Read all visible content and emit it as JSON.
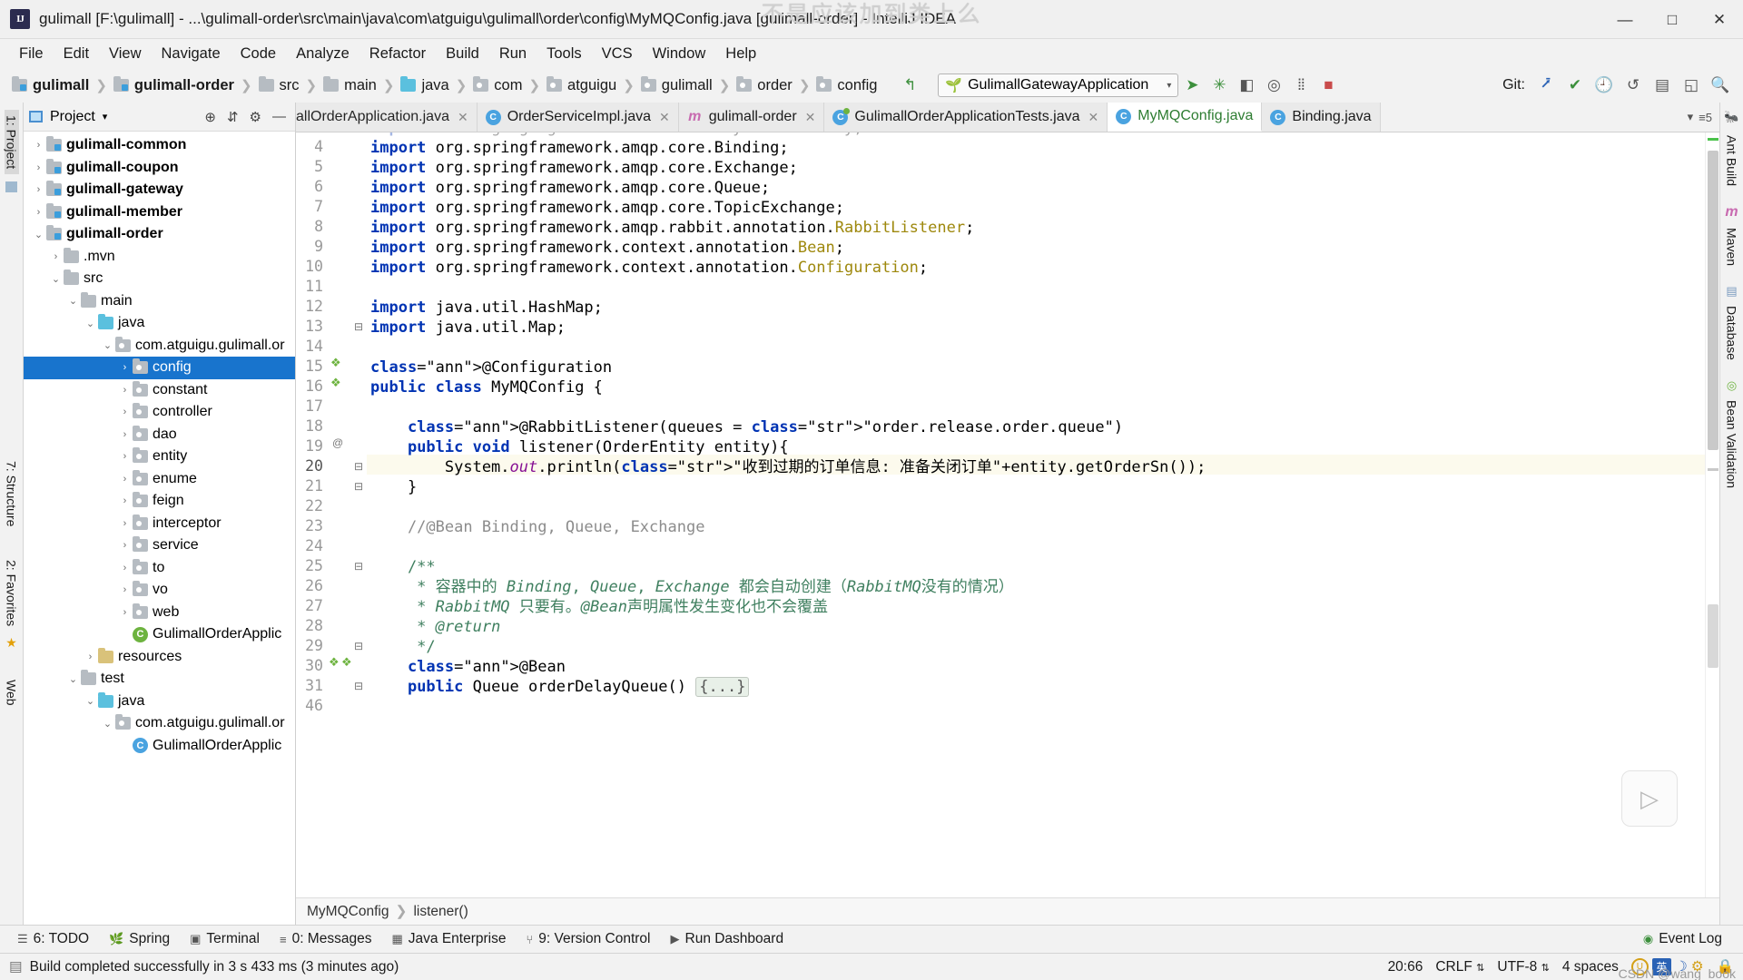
{
  "window": {
    "title": "gulimall [F:\\gulimall] - ...\\gulimall-order\\src\\main\\java\\com\\atguigu\\gulimall\\order\\config\\MyMQConfig.java [gulimall-order] - IntelliJ IDEA",
    "logo_text": "IJ",
    "watermark": "不是应该加到类上么",
    "minimize": "—",
    "maximize": "□",
    "close": "✕"
  },
  "menu": {
    "items": [
      "File",
      "Edit",
      "View",
      "Navigate",
      "Code",
      "Analyze",
      "Refactor",
      "Build",
      "Run",
      "Tools",
      "VCS",
      "Window",
      "Help"
    ]
  },
  "navbar": {
    "breadcrumbs": [
      {
        "label": "gulimall",
        "icon": "module-folder-icon",
        "bold": true,
        "kind": "module"
      },
      {
        "label": "gulimall-order",
        "icon": "module-folder-icon",
        "bold": true,
        "kind": "module"
      },
      {
        "label": "src",
        "icon": "folder-icon",
        "bold": false,
        "kind": "folder"
      },
      {
        "label": "main",
        "icon": "folder-icon",
        "bold": false,
        "kind": "folder"
      },
      {
        "label": "java",
        "icon": "source-folder-icon",
        "bold": false,
        "kind": "source"
      },
      {
        "label": "com",
        "icon": "package-icon",
        "bold": false,
        "kind": "package"
      },
      {
        "label": "atguigu",
        "icon": "package-icon",
        "bold": false,
        "kind": "package"
      },
      {
        "label": "gulimall",
        "icon": "package-icon",
        "bold": false,
        "kind": "package"
      },
      {
        "label": "order",
        "icon": "package-icon",
        "bold": false,
        "kind": "package"
      },
      {
        "label": "config",
        "icon": "package-icon",
        "bold": false,
        "kind": "package"
      }
    ],
    "run_config": "GulimallGatewayApplication",
    "git_label": "Git:",
    "icons": [
      "back-arrow-icon",
      "run-icon",
      "debug-icon",
      "coverage-icon",
      "profile-icon",
      "stop-icon",
      "build-icon",
      "update-project-icon",
      "commit-icon",
      "history-icon",
      "rollback-icon",
      "search-everywhere-icon"
    ]
  },
  "project_panel": {
    "title": "Project",
    "header_icons": [
      "locate-icon",
      "collapse-all-icon",
      "settings-icon",
      "hide-icon"
    ],
    "tree": [
      {
        "label": "gulimall-common",
        "depth": 0,
        "arrow": "right",
        "icon": "module-folder-icon",
        "bold": true,
        "selected": false
      },
      {
        "label": "gulimall-coupon",
        "depth": 0,
        "arrow": "right",
        "icon": "module-folder-icon",
        "bold": true,
        "selected": false
      },
      {
        "label": "gulimall-gateway",
        "depth": 0,
        "arrow": "right",
        "icon": "module-folder-icon",
        "bold": true,
        "selected": false
      },
      {
        "label": "gulimall-member",
        "depth": 0,
        "arrow": "right",
        "icon": "module-folder-icon",
        "bold": true,
        "selected": false
      },
      {
        "label": "gulimall-order",
        "depth": 0,
        "arrow": "down",
        "icon": "module-folder-icon",
        "bold": true,
        "selected": false
      },
      {
        "label": ".mvn",
        "depth": 1,
        "arrow": "right",
        "icon": "folder-icon",
        "bold": false,
        "selected": false
      },
      {
        "label": "src",
        "depth": 1,
        "arrow": "down",
        "icon": "folder-icon",
        "bold": false,
        "selected": false
      },
      {
        "label": "main",
        "depth": 2,
        "arrow": "down",
        "icon": "folder-icon",
        "bold": false,
        "selected": false
      },
      {
        "label": "java",
        "depth": 3,
        "arrow": "down",
        "icon": "source-folder-icon",
        "bold": false,
        "selected": false
      },
      {
        "label": "com.atguigu.gulimall.or",
        "depth": 4,
        "arrow": "down",
        "icon": "package-icon",
        "bold": false,
        "selected": false
      },
      {
        "label": "config",
        "depth": 5,
        "arrow": "right",
        "icon": "package-icon",
        "bold": false,
        "selected": true
      },
      {
        "label": "constant",
        "depth": 5,
        "arrow": "right",
        "icon": "package-icon",
        "bold": false,
        "selected": false
      },
      {
        "label": "controller",
        "depth": 5,
        "arrow": "right",
        "icon": "package-icon",
        "bold": false,
        "selected": false
      },
      {
        "label": "dao",
        "depth": 5,
        "arrow": "right",
        "icon": "package-icon",
        "bold": false,
        "selected": false
      },
      {
        "label": "entity",
        "depth": 5,
        "arrow": "right",
        "icon": "package-icon",
        "bold": false,
        "selected": false
      },
      {
        "label": "enume",
        "depth": 5,
        "arrow": "right",
        "icon": "package-icon",
        "bold": false,
        "selected": false
      },
      {
        "label": "feign",
        "depth": 5,
        "arrow": "right",
        "icon": "package-icon",
        "bold": false,
        "selected": false
      },
      {
        "label": "interceptor",
        "depth": 5,
        "arrow": "right",
        "icon": "package-icon",
        "bold": false,
        "selected": false
      },
      {
        "label": "service",
        "depth": 5,
        "arrow": "right",
        "icon": "package-icon",
        "bold": false,
        "selected": false
      },
      {
        "label": "to",
        "depth": 5,
        "arrow": "right",
        "icon": "package-icon",
        "bold": false,
        "selected": false
      },
      {
        "label": "vo",
        "depth": 5,
        "arrow": "right",
        "icon": "package-icon",
        "bold": false,
        "selected": false
      },
      {
        "label": "web",
        "depth": 5,
        "arrow": "right",
        "icon": "package-icon",
        "bold": false,
        "selected": false
      },
      {
        "label": "GulimallOrderApplic",
        "depth": 5,
        "arrow": "none",
        "icon": "spring-class-icon",
        "bold": false,
        "selected": false
      },
      {
        "label": "resources",
        "depth": 3,
        "arrow": "right",
        "icon": "resources-folder-icon",
        "bold": false,
        "selected": false
      },
      {
        "label": "test",
        "depth": 2,
        "arrow": "down",
        "icon": "folder-icon",
        "bold": false,
        "selected": false
      },
      {
        "label": "java",
        "depth": 3,
        "arrow": "down",
        "icon": "source-folder-icon",
        "bold": false,
        "selected": false
      },
      {
        "label": "com.atguigu.gulimall.or",
        "depth": 4,
        "arrow": "down",
        "icon": "package-icon",
        "bold": false,
        "selected": false
      },
      {
        "label": "GulimallOrderApplic",
        "depth": 5,
        "arrow": "none",
        "icon": "test-class-icon",
        "bold": false,
        "selected": false
      }
    ]
  },
  "left_strip": [
    "1: Project",
    "7: Structure",
    "2: Favorites",
    "Web"
  ],
  "right_strip": [
    "Ant Build",
    "Maven",
    "Database",
    "Bean Validation"
  ],
  "editor_tabs": [
    {
      "label": "allOrderApplication.java",
      "icon": "java-class-icon",
      "active": false,
      "closable": true,
      "truncated": true
    },
    {
      "label": "OrderServiceImpl.java",
      "icon": "java-class-icon",
      "active": false,
      "closable": true
    },
    {
      "label": "gulimall-order",
      "icon": "maven-icon",
      "active": false,
      "closable": true
    },
    {
      "label": "GulimallOrderApplicationTests.java",
      "icon": "test-class-icon",
      "active": false,
      "closable": true
    },
    {
      "label": "MyMQConfig.java",
      "icon": "java-class-icon",
      "active": true,
      "closable": false
    },
    {
      "label": "Binding.java",
      "icon": "java-class-icon",
      "active": false,
      "closable": false
    }
  ],
  "editor": {
    "gutter_line_numbers": [
      "4",
      "5",
      "6",
      "7",
      "8",
      "9",
      "10",
      "11",
      "12",
      "13",
      "14",
      "15",
      "16",
      "17",
      "18",
      "19",
      "20",
      "21",
      "22",
      "23",
      "24",
      "25",
      "26",
      "27",
      "28",
      "29",
      "30",
      "31",
      "46"
    ],
    "highlighted_line": "20",
    "code_lines": [
      "import com.atguigu.gulimall.order.entity.OrderEntity;",
      "import org.springframework.amqp.core.Binding;",
      "import org.springframework.amqp.core.Exchange;",
      "import org.springframework.amqp.core.Queue;",
      "import org.springframework.amqp.core.TopicExchange;",
      "import org.springframework.amqp.rabbit.annotation.RabbitListener;",
      "import org.springframework.context.annotation.Bean;",
      "import org.springframework.context.annotation.Configuration;",
      "",
      "import java.util.HashMap;",
      "import java.util.Map;",
      "",
      "@Configuration",
      "public class MyMQConfig {",
      "",
      "    @RabbitListener(queues = \"order.release.order.queue\")",
      "    public void listener(OrderEntity entity){",
      "        System.out.println(\"收到过期的订单信息: 准备关闭订单\"+entity.getOrderSn());",
      "    }",
      "",
      "    //@Bean Binding, Queue, Exchange",
      "",
      "    /**",
      "     * 容器中的 Binding, Queue, Exchange 都会自动创建（RabbitMQ没有的情况）",
      "     * RabbitMQ 只要有。@Bean声明属性发生变化也不会覆盖",
      "     * @return",
      "     */",
      "    @Bean",
      "    public Queue orderDelayQueue() {...}"
    ],
    "fold_placeholder": "{...}",
    "breadcrumb": [
      "MyMQConfig",
      "listener()"
    ],
    "annotation_marker": "@"
  },
  "bottom_tools": [
    {
      "label": "6: TODO",
      "icon": "todo-icon"
    },
    {
      "label": "Spring",
      "icon": "spring-icon"
    },
    {
      "label": "Terminal",
      "icon": "terminal-icon"
    },
    {
      "label": "0: Messages",
      "icon": "messages-icon"
    },
    {
      "label": "Java Enterprise",
      "icon": "java-enterprise-icon"
    },
    {
      "label": "9: Version Control",
      "icon": "version-control-icon"
    },
    {
      "label": "Run Dashboard",
      "icon": "run-dashboard-icon"
    }
  ],
  "event_log": {
    "label": "Event Log",
    "icon": "event-log-icon"
  },
  "status": {
    "message": "Build completed successfully in 3 s 433 ms (3 minutes ago)",
    "caret_position": "20:66",
    "line_separator": "CRLF",
    "encoding": "UTF-8",
    "indent": "4 spaces",
    "ime_lang": "英",
    "watermark": "CSDN @wang_book"
  },
  "colors": {
    "accent": "#1874cd",
    "selection": "#1874cd",
    "keyword": "#0033b3",
    "string": "#067d17",
    "annotation": "#9e880d",
    "comment": "#8c8c8c",
    "javadoc": "#3f7f5f",
    "highlight_line": "#fcfaed",
    "spring_green": "#6db33f"
  }
}
